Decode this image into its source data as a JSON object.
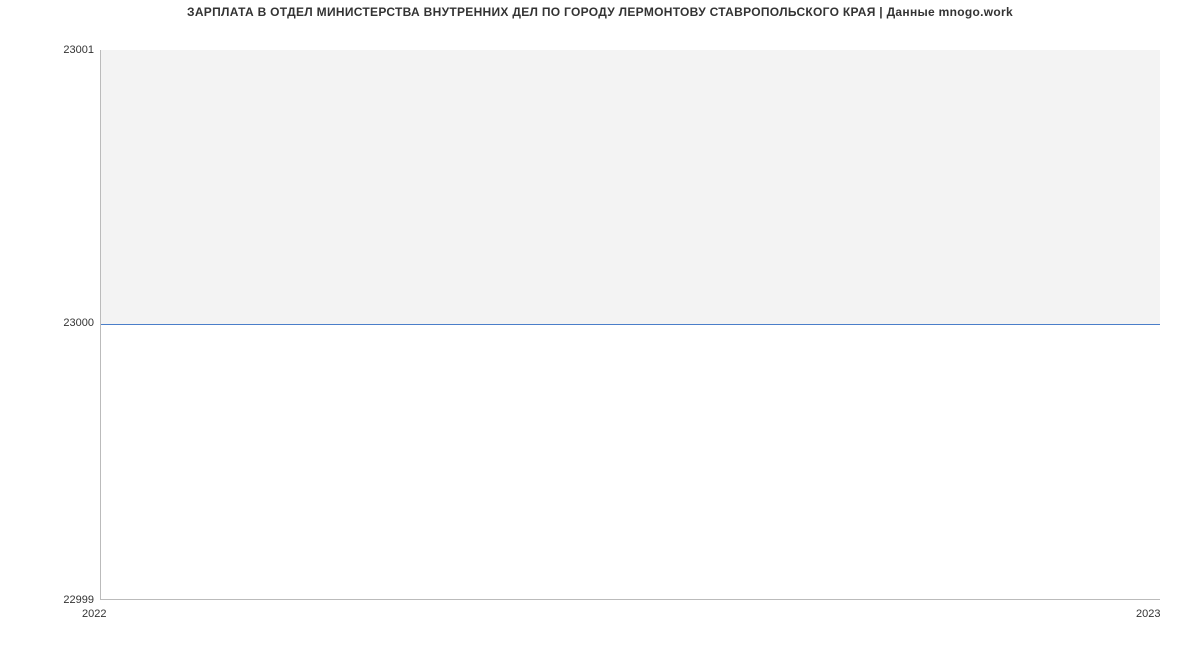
{
  "chart_data": {
    "type": "line",
    "title": "ЗАРПЛАТА В ОТДЕЛ МИНИСТЕРСТВА ВНУТРЕННИХ ДЕЛ ПО ГОРОДУ ЛЕРМОНТОВУ СТАВРОПОЛЬСКОГО КРАЯ | Данные mnogo.work",
    "x": [
      2022,
      2023
    ],
    "values": [
      23000,
      23000
    ],
    "xlabel": "",
    "ylabel": "",
    "xlim": [
      2022,
      2023
    ],
    "ylim": [
      22999,
      23001
    ],
    "x_ticks": [
      "2022",
      "2023"
    ],
    "y_ticks": [
      "22999",
      "23000",
      "23001"
    ],
    "line_color": "#4a7ec9",
    "grid": false
  }
}
